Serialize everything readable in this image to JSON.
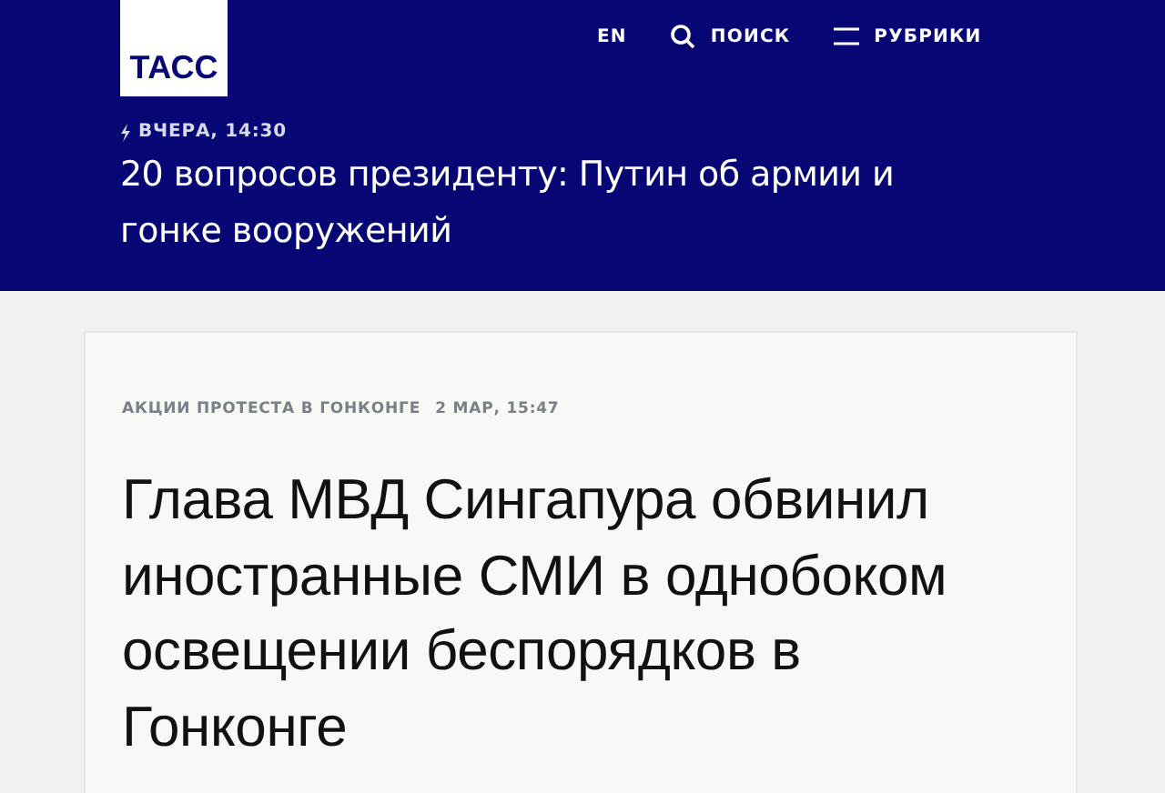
{
  "header": {
    "logo": "ТАСС",
    "nav": [
      {
        "kind": "lang",
        "label": "EN"
      },
      {
        "kind": "search",
        "label": "ПОИСК"
      },
      {
        "kind": "menu",
        "label": "РУБРИКИ"
      }
    ],
    "featured": {
      "urgent": true,
      "time": "ВЧЕРА, 14:30",
      "headline": "20 вопросов президенту: Путин об армии и гонке вооружений"
    }
  },
  "article": {
    "tag": "АКЦИИ ПРОТЕСТА В ГОНКОНГЕ",
    "date": "2 МАР, 15:47",
    "title": "Глава МВД Сингапура обвинил иностранные СМИ в однобоком освещении беспорядков в Гонконге"
  }
}
